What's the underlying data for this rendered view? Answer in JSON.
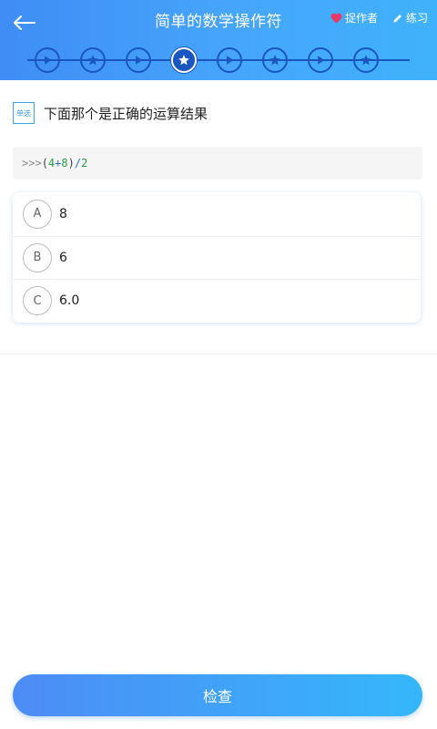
{
  "header": {
    "title": "简单的数学操作符",
    "author_label": "捉作者",
    "practice_label": "练习"
  },
  "progress": {
    "steps": [
      {
        "type": "video"
      },
      {
        "type": "star"
      },
      {
        "type": "video"
      },
      {
        "type": "star",
        "current": true
      },
      {
        "type": "video"
      },
      {
        "type": "star"
      },
      {
        "type": "video"
      },
      {
        "type": "star"
      }
    ]
  },
  "question": {
    "type_badge": "单选",
    "text": "下面那个是正确的运算结果"
  },
  "code": {
    "prompt": ">>>",
    "open_paren": "(",
    "num1": "4",
    "op1": "+",
    "num2": "8",
    "close_paren": ")",
    "op2": "/",
    "num3": "2"
  },
  "options": [
    {
      "letter": "A",
      "text": "8"
    },
    {
      "letter": "B",
      "text": "6"
    },
    {
      "letter": "C",
      "text": "6.0"
    }
  ],
  "check_label": "检查",
  "colors": {
    "header_start": "#3f8df5",
    "header_end": "#3fb2fb",
    "step_dark": "#1a56c0",
    "heart": "#e5396a",
    "badge": "#3aa6f2"
  }
}
